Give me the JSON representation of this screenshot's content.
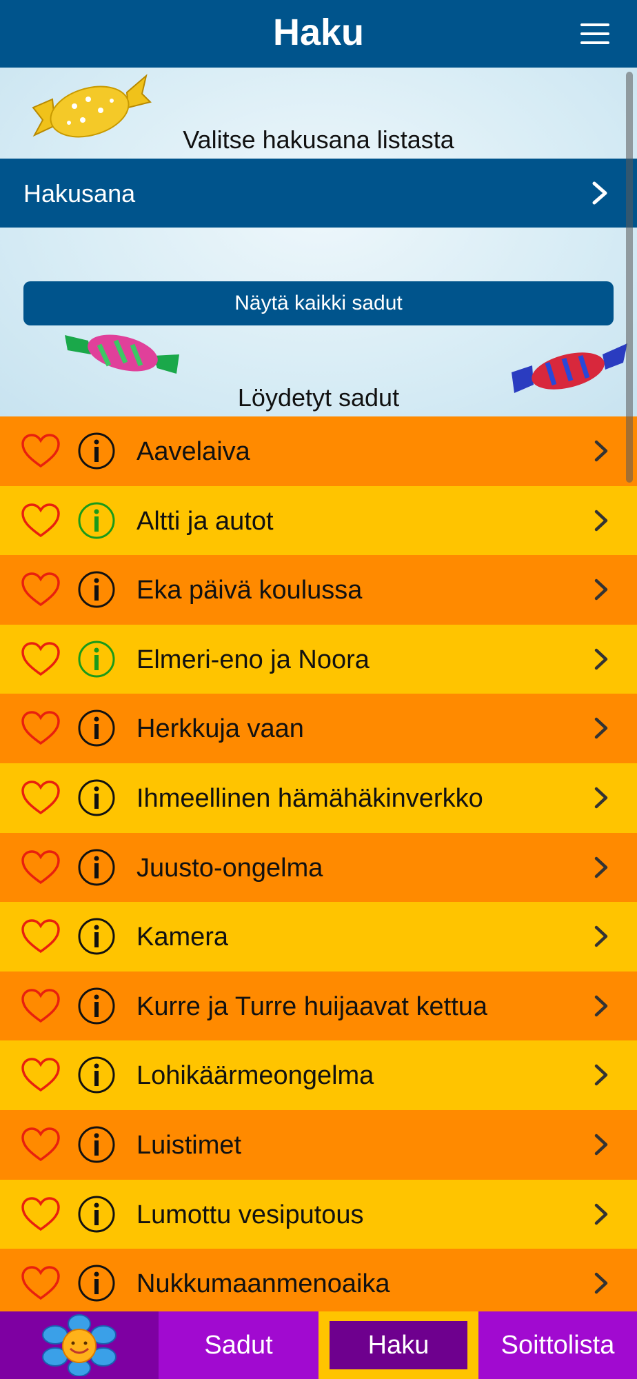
{
  "header": {
    "title": "Haku",
    "menu_icon": "hamburger-icon"
  },
  "search": {
    "prompt": "Valitse hakusana listasta",
    "keyword_label": "Hakusana",
    "show_all_label": "Näytä kaikki sadut",
    "found_title": "Löydetyt sadut"
  },
  "stories": [
    {
      "name": "Aavelaiva",
      "info_color": "#111111"
    },
    {
      "name": "Altti ja autot",
      "info_color": "#1a9a1a"
    },
    {
      "name": "Eka päivä koulussa",
      "info_color": "#111111"
    },
    {
      "name": "Elmeri-eno ja Noora",
      "info_color": "#1a9a1a"
    },
    {
      "name": "Herkkuja vaan",
      "info_color": "#111111"
    },
    {
      "name": "Ihmeellinen hämähäkinverkko",
      "info_color": "#111111"
    },
    {
      "name": "Juusto-ongelma",
      "info_color": "#111111"
    },
    {
      "name": "Kamera",
      "info_color": "#111111"
    },
    {
      "name": "Kurre ja Turre huijaavat kettua",
      "info_color": "#111111"
    },
    {
      "name": "Lohikäärmeongelma",
      "info_color": "#111111"
    },
    {
      "name": "Luistimet",
      "info_color": "#111111"
    },
    {
      "name": "Lumottu vesiputous",
      "info_color": "#111111"
    },
    {
      "name": "Nukkumaanmenoaika",
      "info_color": "#111111"
    }
  ],
  "tabs": {
    "sadut": "Sadut",
    "haku": "Haku",
    "soittolista": "Soittolista"
  },
  "colors": {
    "primary": "#00548c",
    "row_orange": "#ff8a00",
    "row_yellow": "#ffc400",
    "tab_purple": "#9a00c4",
    "heart": "#e8200e"
  }
}
